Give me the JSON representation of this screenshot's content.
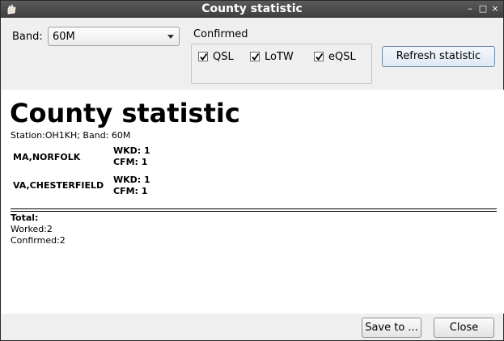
{
  "window": {
    "title": "County statistic"
  },
  "controls": {
    "band_label": "Band:",
    "band_value": "60M",
    "confirmed_label": "Confirmed",
    "checkboxes": [
      {
        "label": "QSL",
        "checked": true
      },
      {
        "label": "LoTW",
        "checked": true
      },
      {
        "label": "eQSL",
        "checked": true
      }
    ],
    "refresh_label": "Refresh statistic"
  },
  "report": {
    "title": "County statistic",
    "subtitle": "Station:OH1KH; Band: 60M",
    "counties": [
      {
        "name": "MA,NORFOLK",
        "wkd": "WKD: 1",
        "cfm": "CFM: 1"
      },
      {
        "name": "VA,CHESTERFIELD",
        "wkd": "WKD: 1",
        "cfm": "CFM: 1"
      }
    ],
    "total_label": "Total:",
    "worked": "Worked:2",
    "confirmed": "Confirmed:2"
  },
  "buttons": {
    "save": "Save to ...",
    "close": "Close"
  }
}
